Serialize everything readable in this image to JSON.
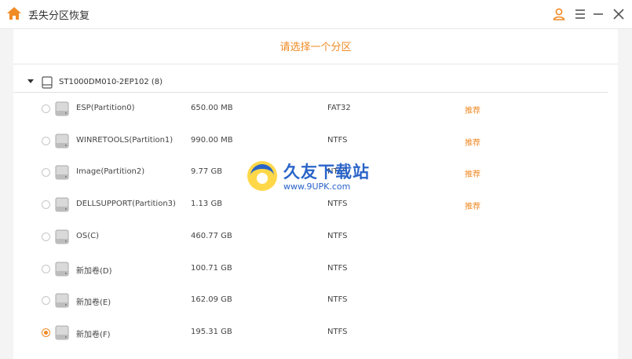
{
  "window": {
    "title": "丢失分区恢复"
  },
  "main": {
    "heading": "请选择一个分区",
    "disk": {
      "label": "ST1000DM010-2EP102 (8)"
    },
    "partitions": [
      {
        "name": "ESP(Partition0)",
        "size": "650.00 MB",
        "fs": "FAT32",
        "tag": "推荐",
        "checked": false
      },
      {
        "name": "WINRETOOLS(Partition1)",
        "size": "990.00 MB",
        "fs": "NTFS",
        "tag": "推荐",
        "checked": false
      },
      {
        "name": "Image(Partition2)",
        "size": "9.77 GB",
        "fs": "NTFS",
        "tag": "推荐",
        "checked": false
      },
      {
        "name": "DELLSUPPORT(Partition3)",
        "size": "1.13 GB",
        "fs": "NTFS",
        "tag": "推荐",
        "checked": false
      },
      {
        "name": "OS(C)",
        "size": "460.77 GB",
        "fs": "NTFS",
        "tag": "",
        "checked": false
      },
      {
        "name": "新加卷(D)",
        "size": "100.71 GB",
        "fs": "NTFS",
        "tag": "",
        "checked": false
      },
      {
        "name": "新加卷(E)",
        "size": "162.09 GB",
        "fs": "NTFS",
        "tag": "",
        "checked": false
      },
      {
        "name": "新加卷(F)",
        "size": "195.31 GB",
        "fs": "NTFS",
        "tag": "",
        "checked": true
      }
    ]
  },
  "watermark": {
    "name": "久友下载站",
    "url": "www.9UPK.com"
  },
  "colors": {
    "accent": "#f08a24",
    "watermark": "#2a64c8"
  },
  "icons": {
    "app": "home-icon",
    "user": "user-icon",
    "menu": "menu-icon",
    "minimize": "minimize-icon",
    "close": "close-icon",
    "disk": "hard-disk-icon",
    "partition": "drive-icon"
  }
}
